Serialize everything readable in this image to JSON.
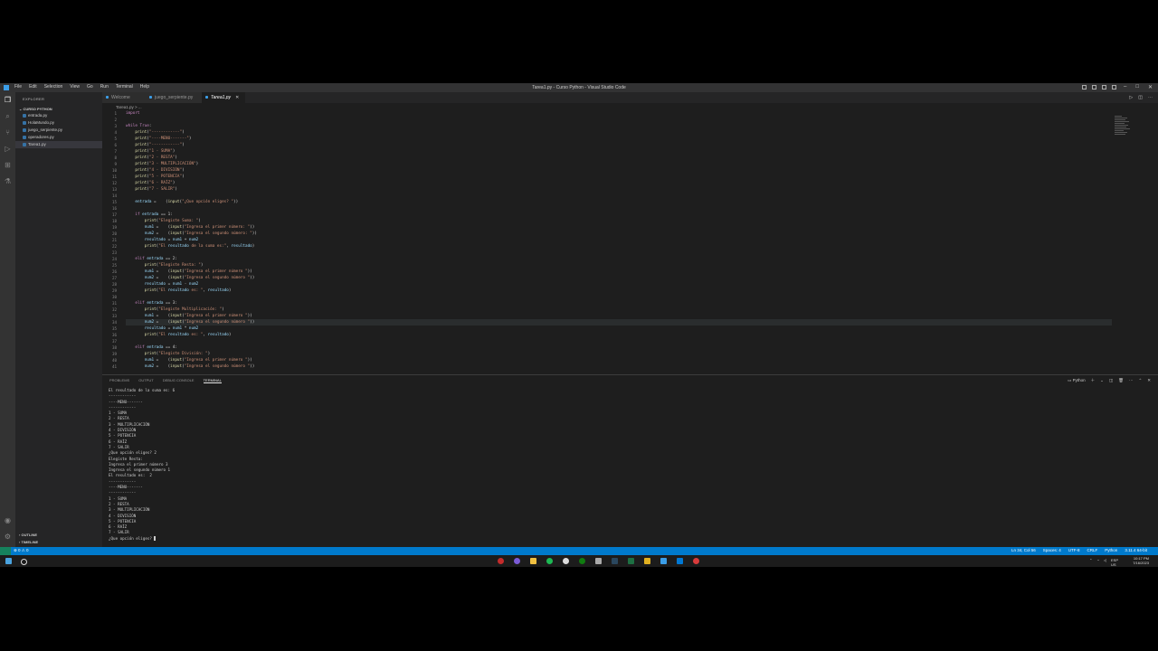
{
  "window": {
    "title": "Tarea1.py - Curso Python - Visual Studio Code",
    "menu": [
      "File",
      "Edit",
      "Selection",
      "View",
      "Go",
      "Run",
      "Terminal",
      "Help"
    ]
  },
  "sidebar": {
    "title": "EXPLORER",
    "section": "CURSO PYTHON",
    "files": [
      "entrada.py",
      "HolaMundo.py",
      "juego_serpiente.py",
      "operadores.py",
      "Tarea1.py"
    ],
    "outline": "OUTLINE",
    "timeline": "TIMELINE"
  },
  "tabs": [
    "Welcome",
    "juego_serpiente.py",
    "Tarea1.py"
  ],
  "breadcrumb": "Tarea1.py > ...",
  "code_lines": [
    "import ",
    "",
    "while True:",
    "    print(\"------------\")",
    "    print(\"----MENU-------\")",
    "    print(\"------------\")",
    "    print(\"1 - SUMA\")",
    "    print(\"2 - RESTA\")",
    "    print(\"3 - MULTIPLICACIÓN\")",
    "    print(\"4 - DIVISIÓN\")",
    "    print(\"5 - POTENCIA\")",
    "    print(\"6 - RAÍZ\")",
    "    print(\"7 - SALIR\")",
    "",
    "    entrada =    (input(\"¿Que opción eliges? \"))",
    "",
    "    if entrada == 1:",
    "        print(\"Elegiste Suma: \")",
    "        num1 =    (input(\"Ingresa el primer número: \"))",
    "        num2 =    (input(\"Ingresa el segundo número: \"))",
    "        resultado = num1 + num2",
    "        print(\"El resultado de la suma es:\", resultado)",
    "",
    "    elif entrada == 2:",
    "        print(\"Elegiste Resta: \")",
    "        num1 =    (input(\"Ingresa el primer número \"))",
    "        num2 =    (input(\"Ingresa el segundo número \"))",
    "        resultado = num1 - num2",
    "        print(\"El resultado es: \", resultado)",
    "",
    "    elif entrada == 3:",
    "        print(\"Elegiste Multiplicación: \")",
    "        num1 =    (input(\"Ingresa el primer número \"))",
    "        num2 =    (input(\"Ingresa el segundo número \"))",
    "        resultado = num1 * num2",
    "        print(\"El resultado es: \", resultado)",
    "",
    "    elif entrada == 4:",
    "        print(\"Elegiste División: \")",
    "        num1 =    (input(\"Ingresa el primer número \"))",
    "        num2 =    (input(\"Ingresa el segundo número \"))"
  ],
  "panel": {
    "tabs": [
      "PROBLEMS",
      "OUTPUT",
      "DEBUG CONSOLE",
      "TERMINAL"
    ],
    "shell": "Python",
    "terminal_lines": [
      "El resultado de la suma es: 6",
      "------------",
      "----MENU-------",
      "------------",
      "1 - SUMA",
      "2 - RESTA",
      "3 - MULTIPLICACIÓN",
      "4 - DIVISIÓN",
      "5 - POTENCIA",
      "6 - RAÍZ",
      "7 - SALIR",
      "¿Que opción eliges? 2",
      "Elegiste Resta:",
      "Ingresa el primer número 3",
      "Ingresa el segundo número 1",
      "El resultado es:  2",
      "------------",
      "----MENU-------",
      "------------",
      "1 - SUMA",
      "2 - RESTA",
      "3 - MULTIPLICACIÓN",
      "4 - DIVISIÓN",
      "5 - POTENCIA",
      "6 - RAÍZ",
      "7 - SALIR",
      "¿Que opción eliges? "
    ]
  },
  "statusbar": {
    "left": "⊗ 0  ⚠ 0",
    "right": [
      "Ln 34, Col 56",
      "Spaces: 4",
      "UTF-8",
      "CRLF",
      "Python",
      "3.11.4 64-bit"
    ]
  },
  "taskbar": {
    "lang": "ESP",
    "region": "US",
    "time": "10:17 PM",
    "date": "7/16/2023"
  },
  "colors": {
    "accent": "#007acc",
    "editor_bg": "#1e1e1e",
    "sidebar_bg": "#252526"
  }
}
